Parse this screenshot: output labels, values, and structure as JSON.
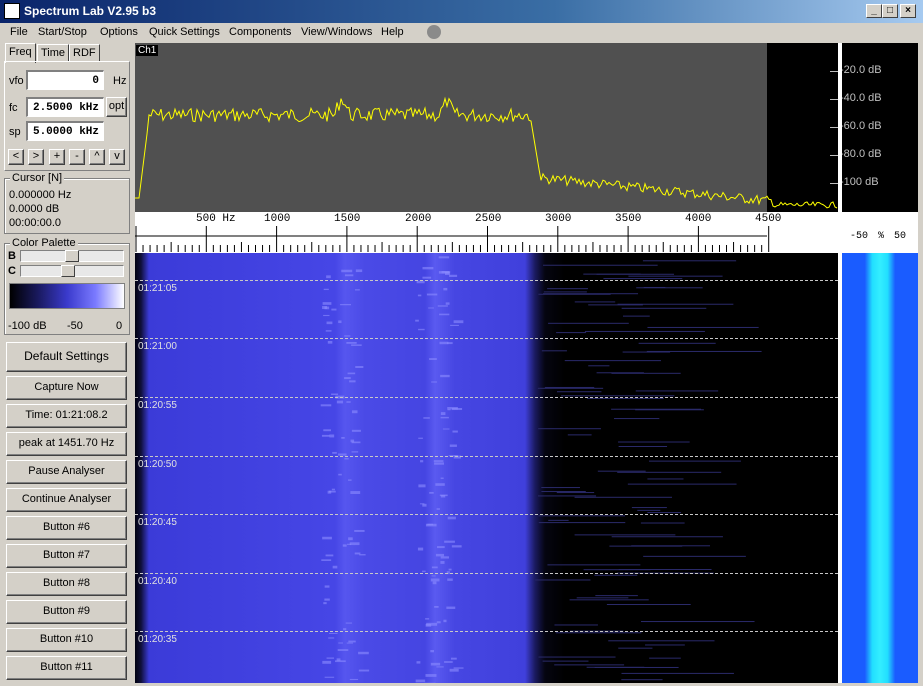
{
  "window": {
    "title": "Spectrum Lab V2.95 b3"
  },
  "menu": [
    "File",
    "Start/Stop",
    "Options",
    "Quick Settings",
    "Components",
    "View/Windows",
    "Help"
  ],
  "tabs": [
    "Freq",
    "Time",
    "RDF"
  ],
  "freq_panel": {
    "vfo_label": "vfo",
    "vfo_value": "0",
    "vfo_unit": "Hz",
    "fc_label": "fc",
    "fc_value": "2.5000 kHz",
    "opt_label": "opt",
    "sp_label": "sp",
    "sp_value": "5.0000 kHz",
    "nav_buttons": [
      "<",
      ">",
      "+",
      "-",
      "^",
      "v"
    ]
  },
  "cursor": {
    "title": "Cursor [N]",
    "freq": "0.000000 Hz",
    "level": "0.0000 dB",
    "time": "00:00:00.0"
  },
  "palette": {
    "title": "Color Palette",
    "b_label": "B",
    "c_label": "C",
    "scale_min": "-100 dB",
    "scale_mid": "-50",
    "scale_max": "0"
  },
  "side_buttons": [
    "Default Settings",
    "Capture Now",
    "Time:  01:21:08.2",
    "peak at 1451.70 Hz",
    "Pause Analyser",
    "Continue Analyser",
    "Button #6",
    "Button #7",
    "Button #8",
    "Button #9",
    "Button #10",
    "Button #11"
  ],
  "spectrum": {
    "channel": "Ch1",
    "db_labels": [
      "-20.0 dB",
      "-40.0 dB",
      "-60.0 dB",
      "-80.0 dB",
      "-100 dB"
    ],
    "freq_labels": [
      "500 Hz",
      "1000",
      "1500",
      "2000",
      "2500",
      "3000",
      "3500",
      "4000",
      "4500"
    ],
    "pct_labels": [
      "-50",
      "%",
      "50"
    ],
    "trace_color": "#ffff00"
  },
  "waterfall": {
    "times": [
      "01:21:05",
      "01:21:00",
      "01:20:55",
      "01:20:50",
      "01:20:45",
      "01:20:40",
      "01:20:35"
    ]
  }
}
